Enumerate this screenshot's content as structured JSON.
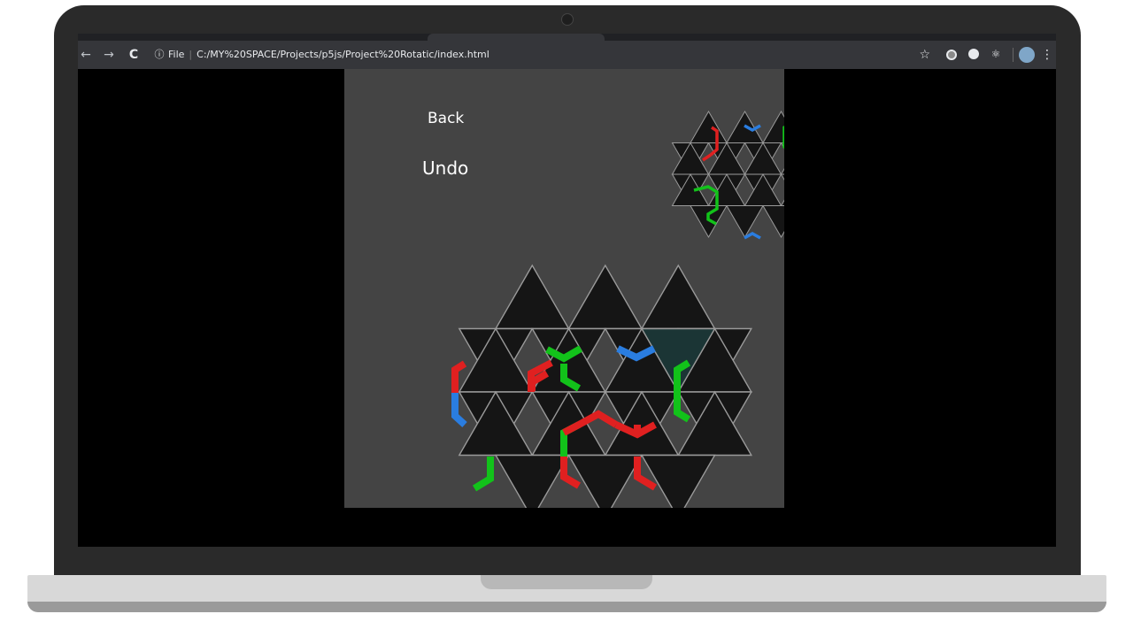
{
  "browser": {
    "nav_back": "←",
    "nav_forward": "→",
    "reload": "C",
    "info_icon": "ⓘ",
    "scheme_label": "File",
    "separator": "|",
    "url": "C:/MY%20SPACE/Projects/p5js/Project%20Rotatic/index.html",
    "star": "☆",
    "menu": "⋮",
    "ext_react": "⚛"
  },
  "game": {
    "back_label": "Back",
    "undo_label": "Undo"
  },
  "colors": {
    "canvas_bg": "#444444",
    "tile_fill": "#151515",
    "tile_stroke": "#9a9a9a",
    "highlight": "#1b3535",
    "red": "#e02020",
    "green": "#12c21a",
    "blue": "#2a7de0"
  },
  "icons": [
    "back-arrow-icon",
    "forward-arrow-icon",
    "reload-icon",
    "info-icon",
    "star-icon",
    "extension-icon",
    "react-icon",
    "profile-icon",
    "menu-icon"
  ]
}
